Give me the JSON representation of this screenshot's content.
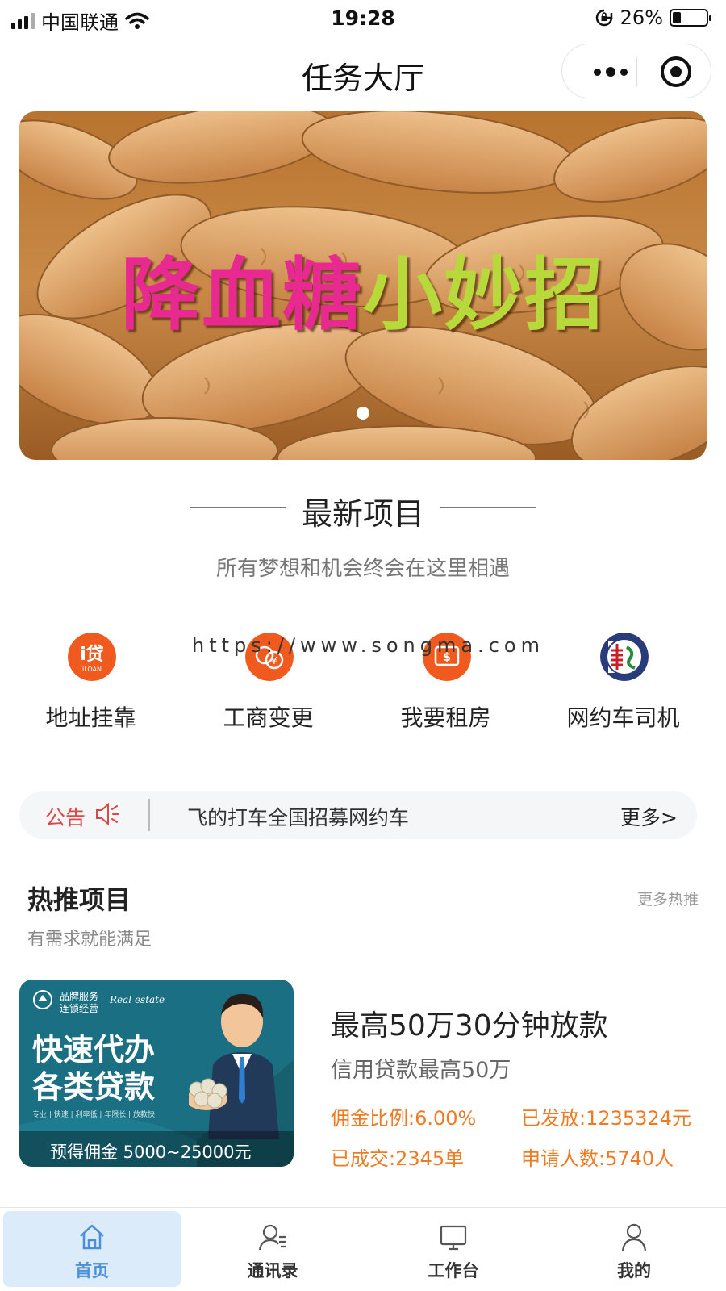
{
  "status_bar": {
    "carrier": "中国联通",
    "time": "19:28",
    "battery": "26%",
    "battery_level": 0.26
  },
  "nav": {
    "title": "任务大厅"
  },
  "banner": {
    "title_chars": [
      "降",
      "血",
      "糖",
      "小",
      "妙",
      "招"
    ],
    "title_colors": [
      "#e8298f",
      "#e8298f",
      "#e8298f",
      "#b8d93a",
      "#b8d93a",
      "#b8d93a"
    ]
  },
  "section": {
    "title": "最新项目",
    "subtitle": "所有梦想和机会终会在这里相遇"
  },
  "watermark": "https://www.songma.com",
  "categories": [
    {
      "label": "地址挂靠",
      "icon": "loan-icon",
      "color": "#f05a1f"
    },
    {
      "label": "工商变更",
      "icon": "coins-icon",
      "color": "#f05a1f"
    },
    {
      "label": "我要租房",
      "icon": "money-bill-icon",
      "color": "#f05a1f"
    },
    {
      "label": "网约车司机",
      "icon": "car-brand-logo-icon",
      "color": "#2a3b7a"
    }
  ],
  "notice": {
    "tag": "公告",
    "text": "飞的打车全国招募网约车",
    "more": "更多>"
  },
  "hot": {
    "title": "热推项目",
    "more": "更多热推",
    "subtitle": "有需求就能满足"
  },
  "product": {
    "image": {
      "brand_line1": "品牌服务",
      "brand_line2": "连锁经营",
      "brand_en": "Real estate",
      "headline1": "快速代办",
      "headline2": "各类贷款",
      "features": "专业 | 快速 | 利率低 | 年限长 | 放款快",
      "commission_bar": "预得佣金 5000~25000元"
    },
    "title": "最高50万30分钟放款",
    "subtitle": "信用贷款最高50万",
    "stats": {
      "commission_rate": "佣金比例:6.00%",
      "issued": "已发放:1235324元",
      "deals": "已成交:2345单",
      "applicants": "申请人数:5740人"
    }
  },
  "tabs": [
    {
      "label": "首页",
      "icon": "home-icon",
      "active": true
    },
    {
      "label": "通讯录",
      "icon": "contacts-icon",
      "active": false
    },
    {
      "label": "工作台",
      "icon": "monitor-icon",
      "active": false
    },
    {
      "label": "我的",
      "icon": "user-icon",
      "active": false
    }
  ],
  "colors": {
    "accent": "#4a8fd8",
    "orange": "#ee7b23",
    "notice_red": "#d74a4a"
  }
}
